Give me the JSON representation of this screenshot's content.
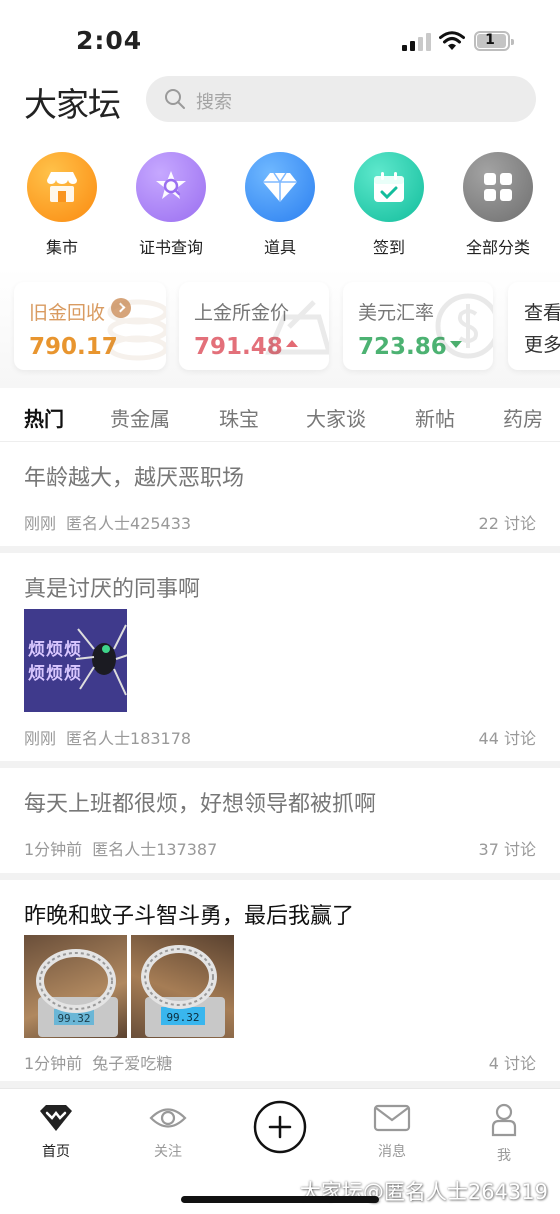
{
  "status": {
    "time": "2:04",
    "battery": "1"
  },
  "header": {
    "logo": "大家坛",
    "search_placeholder": "搜索"
  },
  "categories": [
    {
      "label": "集市",
      "icon": "store-icon",
      "color": "#fb9a1c"
    },
    {
      "label": "证书查询",
      "icon": "certificate-search-icon",
      "color": "#a57df3"
    },
    {
      "label": "道具",
      "icon": "diamond-icon",
      "color": "#3d8ff6"
    },
    {
      "label": "签到",
      "icon": "calendar-check-icon",
      "color": "#1fc7a8"
    },
    {
      "label": "全部分类",
      "icon": "grid-icon",
      "color": "#7d7d7d"
    }
  ],
  "price_cards": [
    {
      "title": "旧金回收",
      "value": "790.17",
      "value_color": "#e8952f",
      "title_color": "#d99b61",
      "trend": ""
    },
    {
      "title": "上金所金价",
      "value": "791.48",
      "value_color": "#e3707a",
      "title_color": "#777777",
      "trend": "up"
    },
    {
      "title": "美元汇率",
      "value": "723.86",
      "value_color": "#4cb272",
      "title_color": "#777777",
      "trend": "down"
    },
    {
      "title": "查看",
      "line2": "更多",
      "title_color": "#333333"
    }
  ],
  "tabs": [
    "热门",
    "贵金属",
    "珠宝",
    "大家谈",
    "新帖",
    "药房"
  ],
  "posts": [
    {
      "title": "年龄越大，越厌恶职场",
      "time": "刚刚",
      "author": "匿名人士425433",
      "count": "22 讨论",
      "title_color": "#777777"
    },
    {
      "title": "真是讨厌的同事啊",
      "time": "刚刚",
      "author": "匿名人士183178",
      "count": "44 讨论",
      "title_color": "#777777",
      "image_text_1": "烦烦烦",
      "image_text_2": "烦烦烦"
    },
    {
      "title": "每天上班都很烦，好想领导都被抓啊",
      "time": "1分钟前",
      "author": "匿名人士137387",
      "count": "37 讨论",
      "title_color": "#777777"
    },
    {
      "title": "昨晚和蚊子斗智斗勇，最后我赢了",
      "time": "1分钟前",
      "author": "兔子爱吃糖",
      "count": "4 讨论",
      "title_color": "#111111",
      "scale_reading_1": "99.32",
      "scale_reading_2": "99.32"
    }
  ],
  "nav": [
    {
      "label": "首页",
      "icon": "home-gem-icon"
    },
    {
      "label": "关注",
      "icon": "eye-icon"
    },
    {
      "label": "",
      "icon": "add-post-icon"
    },
    {
      "label": "消息",
      "icon": "mail-icon"
    },
    {
      "label": "我",
      "icon": "profile-icon"
    }
  ],
  "watermark": "大家坛@匿名人士264319"
}
